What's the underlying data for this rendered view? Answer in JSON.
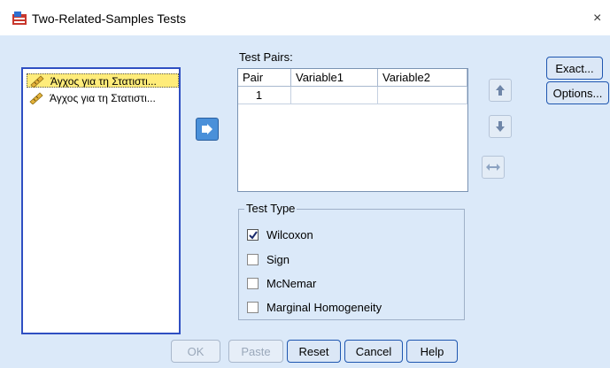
{
  "window": {
    "title": "Two-Related-Samples Tests",
    "close_glyph": "×"
  },
  "variables": [
    {
      "label": "Άγχος για τη Στατιστι...",
      "selected": true,
      "icon": "ruler-pencil-icon"
    },
    {
      "label": "Άγχος για τη Στατιστι...",
      "selected": false,
      "icon": "ruler-pencil-icon"
    }
  ],
  "test_pairs": {
    "label": "Test Pairs:",
    "columns": [
      "Pair",
      "Variable1",
      "Variable2"
    ],
    "rows": [
      {
        "pair": "1",
        "variable1": "",
        "variable2": ""
      }
    ]
  },
  "test_type": {
    "legend": "Test Type",
    "options": [
      {
        "label": "Wilcoxon",
        "checked": true
      },
      {
        "label": "Sign",
        "checked": false
      },
      {
        "label": "McNemar",
        "checked": false
      },
      {
        "label": "Marginal Homogeneity",
        "checked": false
      }
    ]
  },
  "side_buttons": {
    "exact": "Exact...",
    "options": "Options..."
  },
  "bottom_buttons": {
    "ok": "OK",
    "paste": "Paste",
    "reset": "Reset",
    "cancel": "Cancel",
    "help": "Help"
  },
  "colors": {
    "dialog_bg": "#dbe9f9",
    "accent": "#4a90d9",
    "selection": "#ffec7a"
  }
}
